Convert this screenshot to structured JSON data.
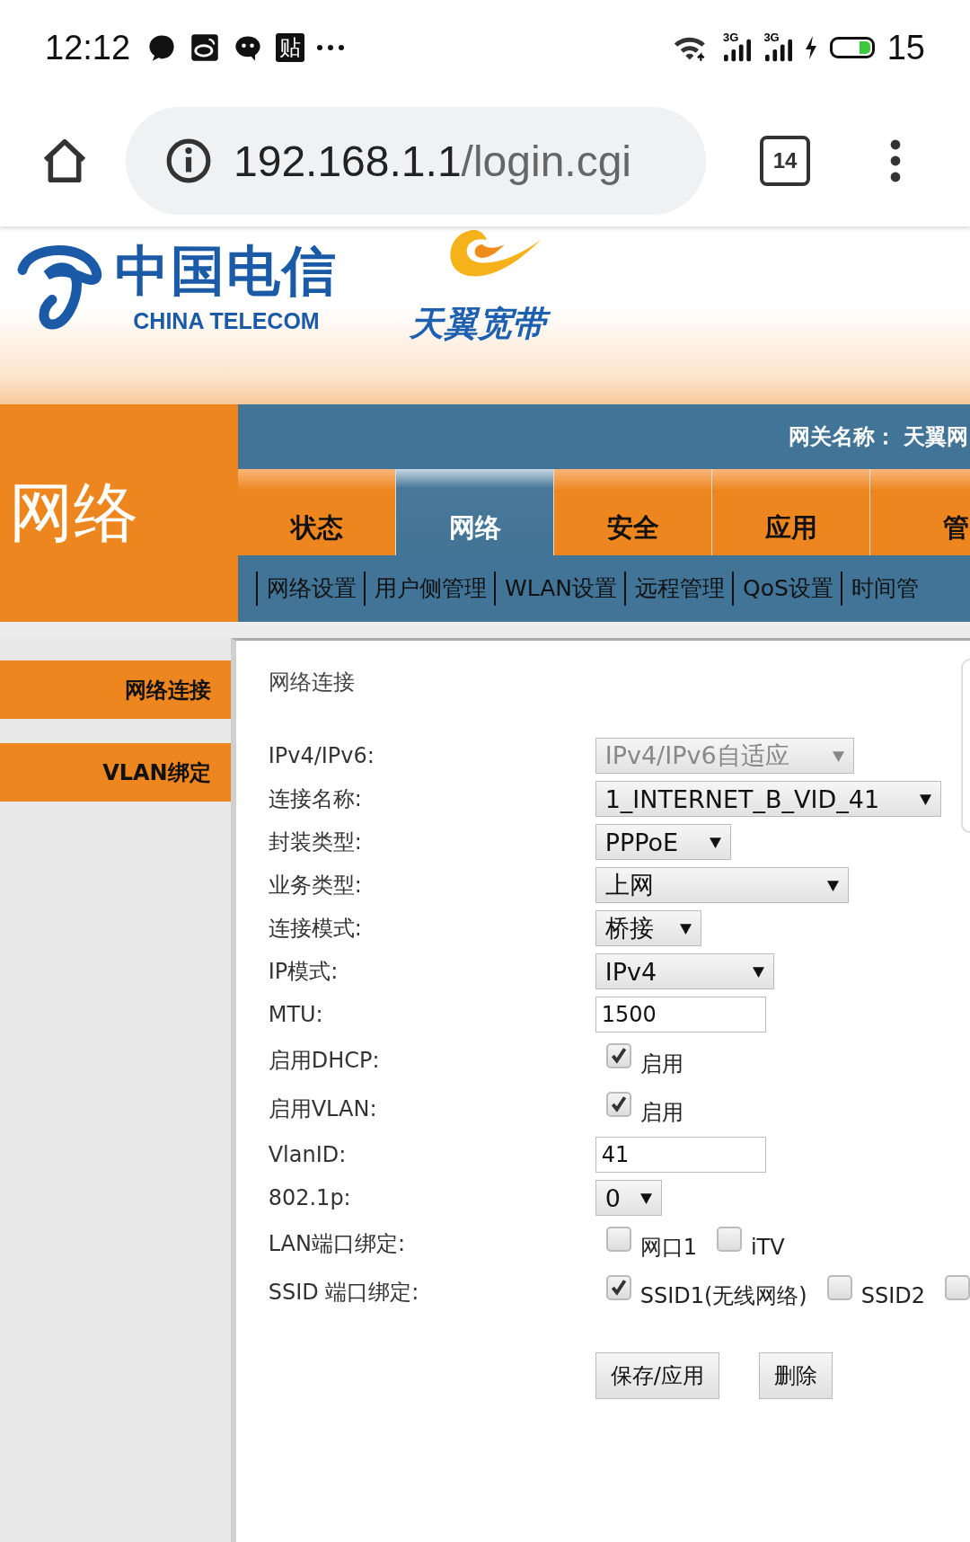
{
  "status_bar": {
    "time": "12:12",
    "app_badge": "贴",
    "battery": {
      "level": 0.3,
      "charging": true
    },
    "battery_text": "15",
    "network_1": "3G",
    "network_2": "3G"
  },
  "browser": {
    "url_host": "192.168.1.1",
    "url_path": "/login.cgi",
    "tab_count": "14"
  },
  "header": {
    "logo_cn": "中国电信",
    "logo_en": "CHINA TELECOM",
    "brand": "天翼宽带"
  },
  "section_title": "网络",
  "gateway_label": "网关名称：",
  "gateway_name": "天翼网",
  "tabs": [
    {
      "label": "状态",
      "selected": false
    },
    {
      "label": "网络",
      "selected": true
    },
    {
      "label": "安全",
      "selected": false
    },
    {
      "label": "应用",
      "selected": false
    },
    {
      "label": "管",
      "selected": false
    }
  ],
  "subnav": [
    "网络设置",
    "用户侧管理",
    "WLAN设置",
    "远程管理",
    "QoS设置",
    "时间管"
  ],
  "sidebar": [
    "网络连接",
    "VLAN绑定"
  ],
  "form": {
    "title": "网络连接",
    "rows": [
      {
        "kind": "select",
        "label": "IPv4/IPv6:",
        "value": "IPv4/IPv6自适应",
        "disabled": true
      },
      {
        "kind": "select",
        "label": "连接名称:",
        "value": "1_INTERNET_B_VID_41",
        "disabled": false
      },
      {
        "kind": "select",
        "label": "封装类型:",
        "value": "PPPoE",
        "disabled": false
      },
      {
        "kind": "select",
        "label": "业务类型:",
        "value": "上网",
        "disabled": false
      },
      {
        "kind": "select",
        "label": "连接模式:",
        "value": "桥接",
        "disabled": false
      },
      {
        "kind": "select",
        "label": "IP模式:",
        "value": "IPv4",
        "disabled": false
      },
      {
        "kind": "input",
        "label": "MTU:",
        "value": "1500"
      },
      {
        "kind": "checks",
        "label": "启用DHCP:",
        "options": [
          {
            "label": "启用",
            "checked": true
          }
        ]
      },
      {
        "kind": "checks",
        "label": "启用VLAN:",
        "options": [
          {
            "label": "启用",
            "checked": true
          }
        ]
      },
      {
        "kind": "input",
        "label": "VlanID:",
        "value": "41"
      },
      {
        "kind": "select",
        "label": "802.1p:",
        "value": "0",
        "disabled": false
      },
      {
        "kind": "checks",
        "label": "LAN端口绑定:",
        "options": [
          {
            "label": "网口1",
            "checked": false
          },
          {
            "label": "iTV",
            "checked": false
          }
        ]
      },
      {
        "kind": "checks",
        "label": "SSID 端口绑定:",
        "options": [
          {
            "label": "SSID1(无线网络)",
            "checked": true
          },
          {
            "label": "SSID2",
            "checked": false
          },
          {
            "checked": false
          }
        ]
      }
    ],
    "buttons": [
      "保存/应用",
      "删除"
    ]
  }
}
